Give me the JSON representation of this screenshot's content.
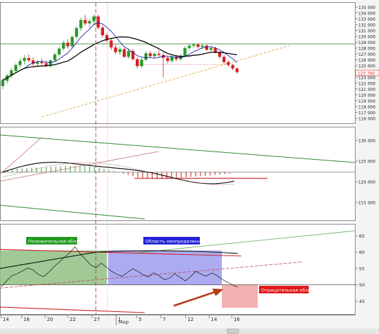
{
  "chart_data": [
    {
      "type": "candlestick",
      "panel": "price",
      "y_ticks": [
        "135 000",
        "134 000",
        "133 000",
        "132 000",
        "131 000",
        "130 000",
        "129 000",
        "128 000",
        "127 000",
        "126 000",
        "125 000",
        "124 000",
        "123 000",
        "122 000",
        "121 000",
        "120 000",
        "119 000",
        "118 000",
        "117 000",
        "116 000"
      ],
      "ylim": [
        115500,
        135500
      ],
      "last_price_label": "123 740",
      "candles": [
        {
          "o": 121500,
          "h": 122800,
          "l": 121000,
          "c": 122500
        },
        {
          "o": 122400,
          "h": 123600,
          "l": 121900,
          "c": 123300
        },
        {
          "o": 123300,
          "h": 124500,
          "l": 122900,
          "c": 124200
        },
        {
          "o": 124100,
          "h": 125400,
          "l": 123800,
          "c": 125100
        },
        {
          "o": 125100,
          "h": 126200,
          "l": 124700,
          "c": 125800
        },
        {
          "o": 125800,
          "h": 126800,
          "l": 125200,
          "c": 126300
        },
        {
          "o": 126300,
          "h": 126900,
          "l": 125600,
          "c": 125900
        },
        {
          "o": 125900,
          "h": 126400,
          "l": 124900,
          "c": 125300
        },
        {
          "o": 125300,
          "h": 126000,
          "l": 124800,
          "c": 125600
        },
        {
          "o": 125600,
          "h": 126200,
          "l": 125100,
          "c": 125400
        },
        {
          "o": 125400,
          "h": 125900,
          "l": 124700,
          "c": 125000
        },
        {
          "o": 125000,
          "h": 126100,
          "l": 124600,
          "c": 125900
        },
        {
          "o": 125900,
          "h": 127200,
          "l": 125600,
          "c": 126900
        },
        {
          "o": 126900,
          "h": 128200,
          "l": 126500,
          "c": 127900
        },
        {
          "o": 127900,
          "h": 129300,
          "l": 127500,
          "c": 128900
        },
        {
          "o": 128900,
          "h": 129500,
          "l": 127900,
          "c": 128300
        },
        {
          "o": 128300,
          "h": 130200,
          "l": 128000,
          "c": 129900
        },
        {
          "o": 129900,
          "h": 131800,
          "l": 129500,
          "c": 131400
        },
        {
          "o": 131400,
          "h": 133200,
          "l": 130900,
          "c": 132800
        },
        {
          "o": 132800,
          "h": 133600,
          "l": 131800,
          "c": 132200
        },
        {
          "o": 132200,
          "h": 133000,
          "l": 131500,
          "c": 132600
        },
        {
          "o": 132600,
          "h": 133800,
          "l": 131900,
          "c": 133400
        },
        {
          "o": 133400,
          "h": 133700,
          "l": 131200,
          "c": 131500
        },
        {
          "o": 131500,
          "h": 131900,
          "l": 129800,
          "c": 130200
        },
        {
          "o": 130200,
          "h": 130600,
          "l": 128900,
          "c": 129300
        },
        {
          "o": 129300,
          "h": 129600,
          "l": 127700,
          "c": 128100
        },
        {
          "o": 128100,
          "h": 128600,
          "l": 126900,
          "c": 127300
        },
        {
          "o": 127300,
          "h": 128200,
          "l": 126800,
          "c": 127800
        },
        {
          "o": 127800,
          "h": 128000,
          "l": 126300,
          "c": 126500
        },
        {
          "o": 126500,
          "h": 127900,
          "l": 126200,
          "c": 127500
        },
        {
          "o": 127500,
          "h": 127800,
          "l": 125800,
          "c": 126100
        },
        {
          "o": 126100,
          "h": 126400,
          "l": 124500,
          "c": 124900
        },
        {
          "o": 124900,
          "h": 126300,
          "l": 124600,
          "c": 126000
        },
        {
          "o": 126000,
          "h": 127400,
          "l": 125700,
          "c": 127100
        },
        {
          "o": 127100,
          "h": 127500,
          "l": 126300,
          "c": 126600
        },
        {
          "o": 126600,
          "h": 127300,
          "l": 126200,
          "c": 127000
        },
        {
          "o": 127000,
          "h": 127600,
          "l": 126500,
          "c": 126800
        },
        {
          "o": 126800,
          "h": 127200,
          "l": 123000,
          "c": 126300
        },
        {
          "o": 126300,
          "h": 126700,
          "l": 125400,
          "c": 125800
        },
        {
          "o": 125800,
          "h": 126900,
          "l": 125500,
          "c": 126500
        },
        {
          "o": 126500,
          "h": 126800,
          "l": 125700,
          "c": 126100
        },
        {
          "o": 126100,
          "h": 127000,
          "l": 125800,
          "c": 126700
        },
        {
          "o": 126700,
          "h": 128300,
          "l": 126400,
          "c": 128000
        },
        {
          "o": 128000,
          "h": 128800,
          "l": 127700,
          "c": 128400
        },
        {
          "o": 128400,
          "h": 128900,
          "l": 128000,
          "c": 128600
        },
        {
          "o": 128600,
          "h": 128800,
          "l": 127900,
          "c": 128200
        },
        {
          "o": 128200,
          "h": 128700,
          "l": 127800,
          "c": 128400
        },
        {
          "o": 128400,
          "h": 128600,
          "l": 127500,
          "c": 127700
        },
        {
          "o": 127700,
          "h": 128300,
          "l": 127400,
          "c": 128000
        },
        {
          "o": 128000,
          "h": 128200,
          "l": 127100,
          "c": 127300
        },
        {
          "o": 127300,
          "h": 127500,
          "l": 126200,
          "c": 126500
        },
        {
          "o": 126500,
          "h": 126800,
          "l": 125300,
          "c": 125600
        },
        {
          "o": 125600,
          "h": 125900,
          "l": 124800,
          "c": 125100
        },
        {
          "o": 125100,
          "h": 125300,
          "l": 124200,
          "c": 124500
        },
        {
          "o": 124500,
          "h": 124700,
          "l": 123600,
          "c": 123900
        }
      ],
      "ma_fast_color": "#1a1aa8",
      "ma_slow_color": "#000000",
      "up_color": "#2a9a2a",
      "down_color": "#d62020"
    },
    {
      "type": "line",
      "panel": "oscillator",
      "y_ticks": [
        "130 000",
        "125 000",
        "120 000",
        "115 000"
      ],
      "ylim": [
        111000,
        133000
      ],
      "histogram_colors": {
        "up": "#5aa55a",
        "down": "#c83a3a"
      }
    },
    {
      "type": "line",
      "panel": "rsi",
      "y_ticks": [
        "65",
        "60",
        "55",
        "50",
        "45"
      ],
      "ylim": [
        41.5,
        68
      ],
      "series": [
        {
          "values": [
            49.5,
            51.2,
            52.8,
            53.4,
            54.2,
            55.1,
            54.6,
            53.2,
            52.5,
            53.8,
            55.5,
            56.9,
            58.4,
            59.8,
            61.6,
            59.5,
            57.8,
            56.1,
            55.2,
            56.6,
            55.4,
            54.1,
            53.2,
            52.6,
            53.8,
            54.9,
            54.1,
            53.0,
            52.4,
            53.7,
            52.8,
            51.6,
            52.0,
            53.4,
            52.3,
            51.2,
            52.5,
            54.1,
            53.3,
            52.6,
            53.6,
            52.9,
            51.7,
            50.8,
            50.0,
            49.3
          ]
        }
      ],
      "labels": {
        "positive": "Положительная область",
        "uncertain": "Область неопределенности",
        "negative": "Отрицательная область"
      },
      "colors": {
        "positive_fill": "#8fbf84",
        "uncertain_fill": "#9e9cf0",
        "negative_fill": "#f2b0b0",
        "positive_label_bg": "#1f9a1f",
        "uncertain_label_bg": "#2020d8",
        "negative_label_bg": "#e01818",
        "arrow": "#b23a1a"
      }
    }
  ],
  "x_axis": {
    "day_labels": [
      "14",
      "16",
      "20",
      "22",
      "27",
      "1",
      "5",
      "7",
      "12",
      "14",
      "16"
    ],
    "month_label": "Мар"
  }
}
